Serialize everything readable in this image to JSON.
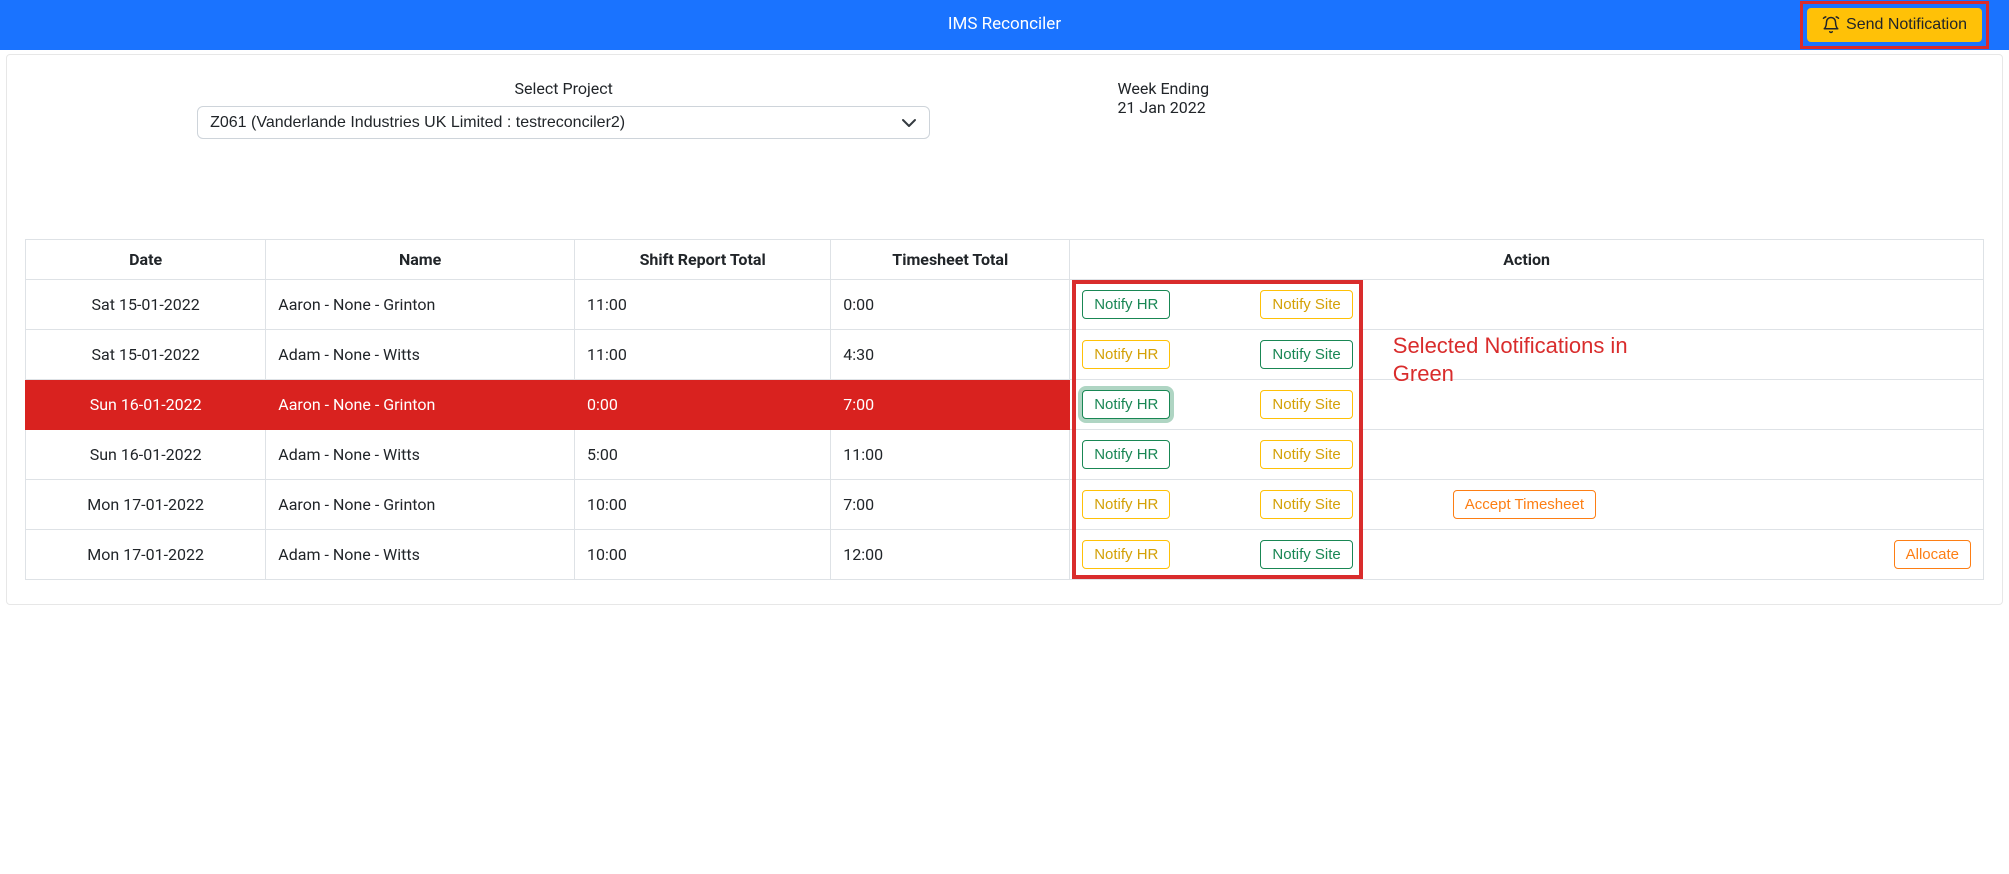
{
  "header": {
    "title": "IMS Reconciler",
    "send_notification_label": "Send Notification"
  },
  "filters": {
    "select_project_label": "Select Project",
    "project_selected": "Z061 (Vanderlande Industries UK Limited : testreconciler2)",
    "week_ending_label": "Week Ending",
    "week_ending_value": "21 Jan 2022"
  },
  "table": {
    "headers": {
      "date": "Date",
      "name": "Name",
      "shift_report_total": "Shift Report Total",
      "timesheet_total": "Timesheet Total",
      "action": "Action"
    },
    "button_labels": {
      "notify_hr": "Notify HR",
      "notify_site": "Notify Site",
      "accept_timesheet": "Accept Timesheet",
      "allocate": "Allocate"
    },
    "rows": [
      {
        "date": "Sat 15-01-2022",
        "name": "Aaron - None - Grinton",
        "shift_total": "11:00",
        "timesheet_total": "0:00",
        "hr_state": "green",
        "site_state": "yellow",
        "highlight": false,
        "hr_focus": false,
        "extra": null
      },
      {
        "date": "Sat 15-01-2022",
        "name": "Adam - None - Witts",
        "shift_total": "11:00",
        "timesheet_total": "4:30",
        "hr_state": "yellow",
        "site_state": "green",
        "highlight": false,
        "hr_focus": false,
        "extra": null
      },
      {
        "date": "Sun 16-01-2022",
        "name": "Aaron - None - Grinton",
        "shift_total": "0:00",
        "timesheet_total": "7:00",
        "hr_state": "green",
        "site_state": "yellow",
        "highlight": true,
        "hr_focus": true,
        "extra": null
      },
      {
        "date": "Sun 16-01-2022",
        "name": "Adam - None - Witts",
        "shift_total": "5:00",
        "timesheet_total": "11:00",
        "hr_state": "green",
        "site_state": "yellow",
        "highlight": false,
        "hr_focus": false,
        "extra": null
      },
      {
        "date": "Mon 17-01-2022",
        "name": "Aaron - None - Grinton",
        "shift_total": "10:00",
        "timesheet_total": "7:00",
        "hr_state": "yellow",
        "site_state": "yellow",
        "highlight": false,
        "hr_focus": false,
        "extra": "accept"
      },
      {
        "date": "Mon 17-01-2022",
        "name": "Adam - None - Witts",
        "shift_total": "10:00",
        "timesheet_total": "12:00",
        "hr_state": "yellow",
        "site_state": "green",
        "highlight": false,
        "hr_focus": false,
        "extra": "allocate"
      }
    ]
  },
  "annotation": {
    "text": "Selected Notifications in Green"
  }
}
